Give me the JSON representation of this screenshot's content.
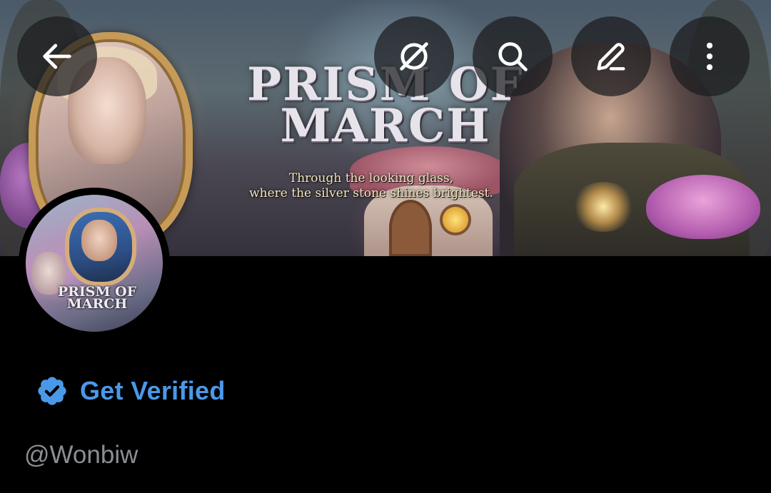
{
  "banner": {
    "title": "PRISM OF\nMARCH",
    "tagline": "Through the looking glass,\nwhere the silver stone shines brightest."
  },
  "header": {
    "buttons": [
      {
        "name": "back",
        "icon": "arrow-left-icon"
      },
      {
        "name": "grok",
        "icon": "grok-icon"
      },
      {
        "name": "search",
        "icon": "search-icon"
      },
      {
        "name": "edit",
        "icon": "pencil-icon"
      },
      {
        "name": "more",
        "icon": "more-vertical-icon"
      }
    ]
  },
  "profile": {
    "avatar_title": "PRISM OF\nMARCH",
    "get_verified_label": "Get Verified",
    "verified_icon": "verified-badge-icon",
    "handle": "@Wonbiw"
  },
  "colors": {
    "background": "#000000",
    "accent_blue": "#4a99e9",
    "handle_gray": "#8b8f94",
    "button_bg": "rgba(28,28,30,0.72)"
  }
}
